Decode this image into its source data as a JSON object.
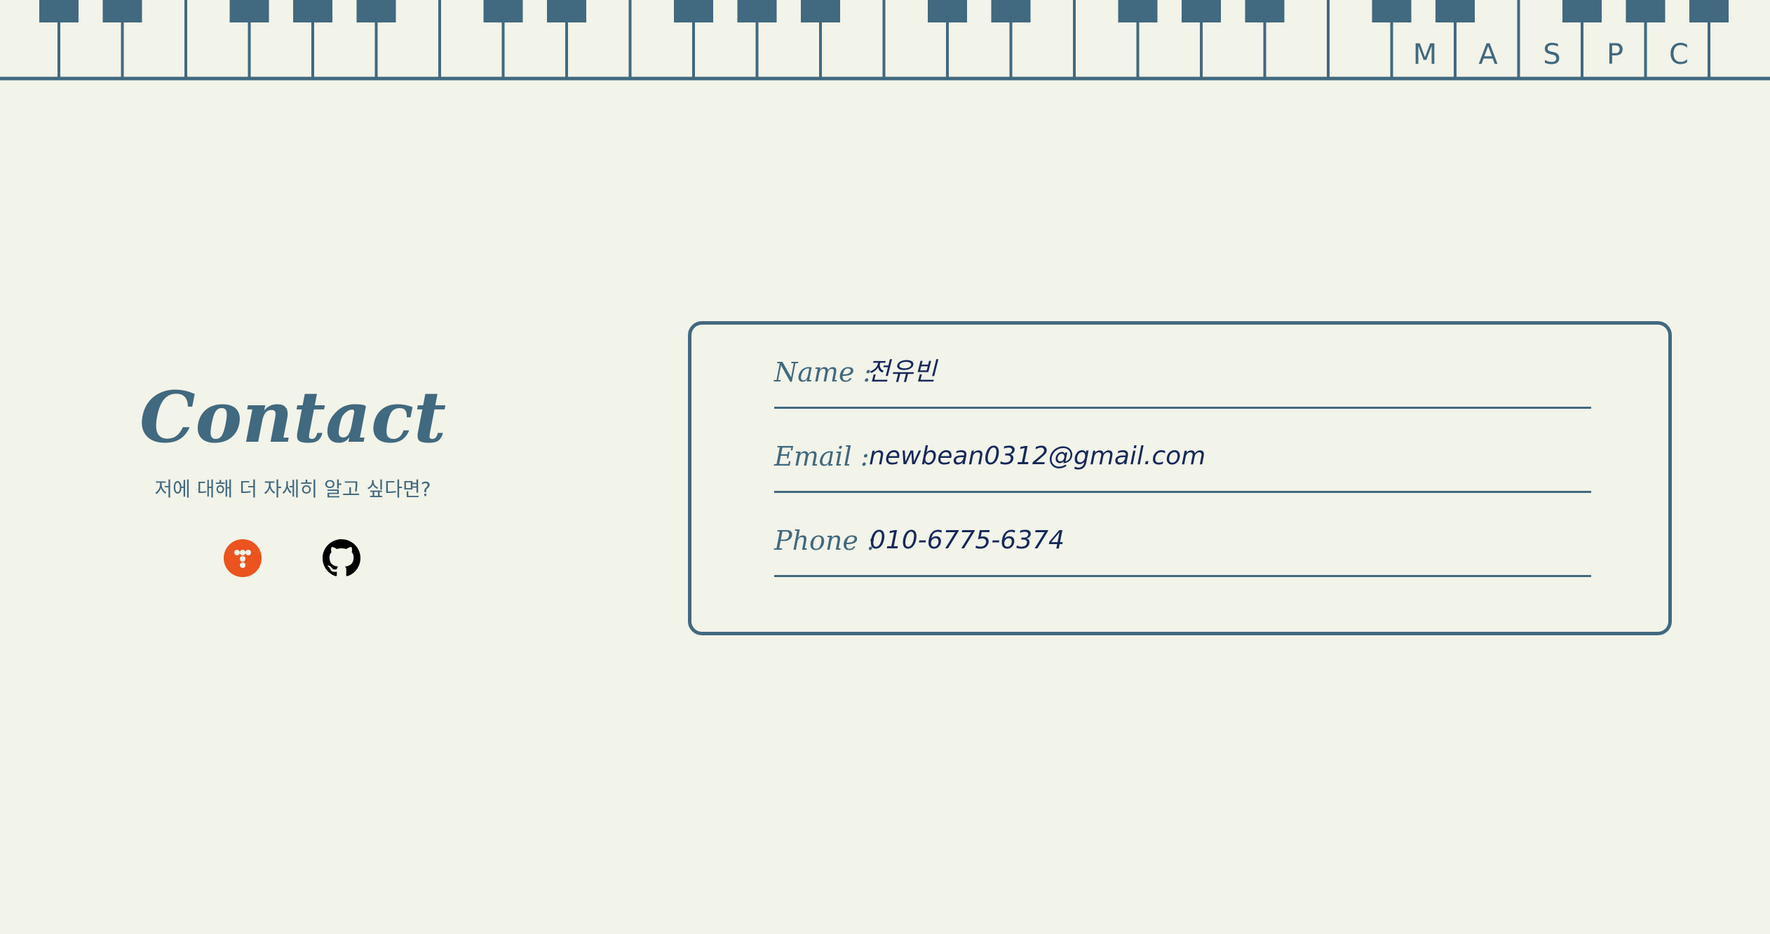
{
  "colors": {
    "background": "#f2f3e9",
    "accent": "#41697f",
    "value_text": "#15285a",
    "tistory_orange": "#eb531f",
    "github_black": "#000000"
  },
  "nav": {
    "items": [
      {
        "label": "M"
      },
      {
        "label": "A"
      },
      {
        "label": "S"
      },
      {
        "label": "P"
      },
      {
        "label": "C"
      }
    ]
  },
  "contact": {
    "title": "Contact",
    "subtitle": "저에 대해 더 자세히 알고 싶다면?",
    "social": [
      {
        "icon": "tistory-icon"
      },
      {
        "icon": "github-icon"
      }
    ]
  },
  "info": {
    "name_label": "Name :",
    "name_value": "전유빈",
    "email_label": "Email :",
    "email_value": "newbean0312@gmail.com",
    "phone_label": "Phone :",
    "phone_value": "010-6775-6374"
  }
}
